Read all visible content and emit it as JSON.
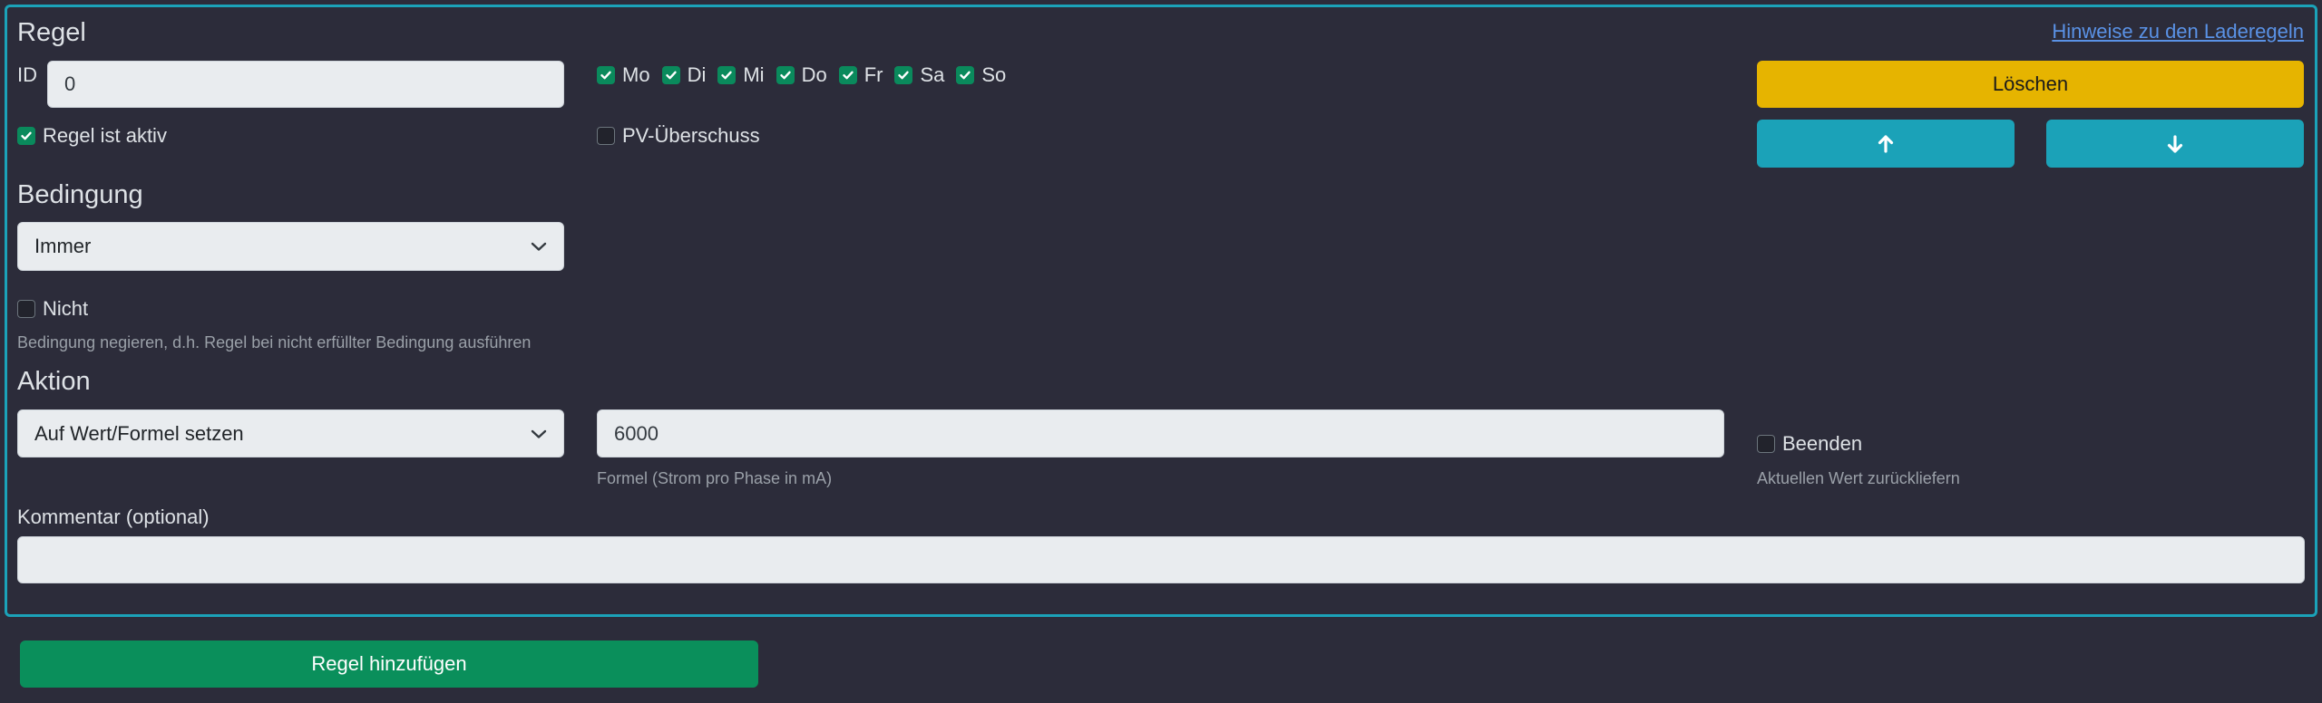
{
  "rule": {
    "title": "Regel",
    "hint_link": "Hinweise zu den Laderegeln",
    "id_label": "ID",
    "id_value": "0",
    "active_label": "Regel ist aktiv",
    "active_checked": true,
    "days": [
      {
        "label": "Mo",
        "checked": true
      },
      {
        "label": "Di",
        "checked": true
      },
      {
        "label": "Mi",
        "checked": true
      },
      {
        "label": "Do",
        "checked": true
      },
      {
        "label": "Fr",
        "checked": true
      },
      {
        "label": "Sa",
        "checked": true
      },
      {
        "label": "So",
        "checked": true
      }
    ],
    "pv_label": "PV-Überschuss",
    "pv_checked": false,
    "delete_label": "Löschen",
    "condition": {
      "title": "Bedingung",
      "selected": "Immer",
      "negate_label": "Nicht",
      "negate_checked": false,
      "negate_hint": "Bedingung negieren, d.h. Regel bei nicht erfüllter Bedingung ausführen"
    },
    "action": {
      "title": "Aktion",
      "selected": "Auf Wert/Formel setzen",
      "formula_value": "6000",
      "formula_hint": "Formel (Strom pro Phase in mA)",
      "end_label": "Beenden",
      "end_checked": false,
      "end_hint": "Aktuellen Wert zurückliefern"
    },
    "comment": {
      "label": "Kommentar (optional)",
      "value": ""
    }
  },
  "add_rule_label": "Regel hinzufügen",
  "colors": {
    "background": "#2c2c3a",
    "panel_border": "#1ba2b8",
    "warning": "#e6b400",
    "info": "#1ba2b8",
    "success": "#0a8f5b",
    "checkbox_on": "#0a8a5c"
  }
}
